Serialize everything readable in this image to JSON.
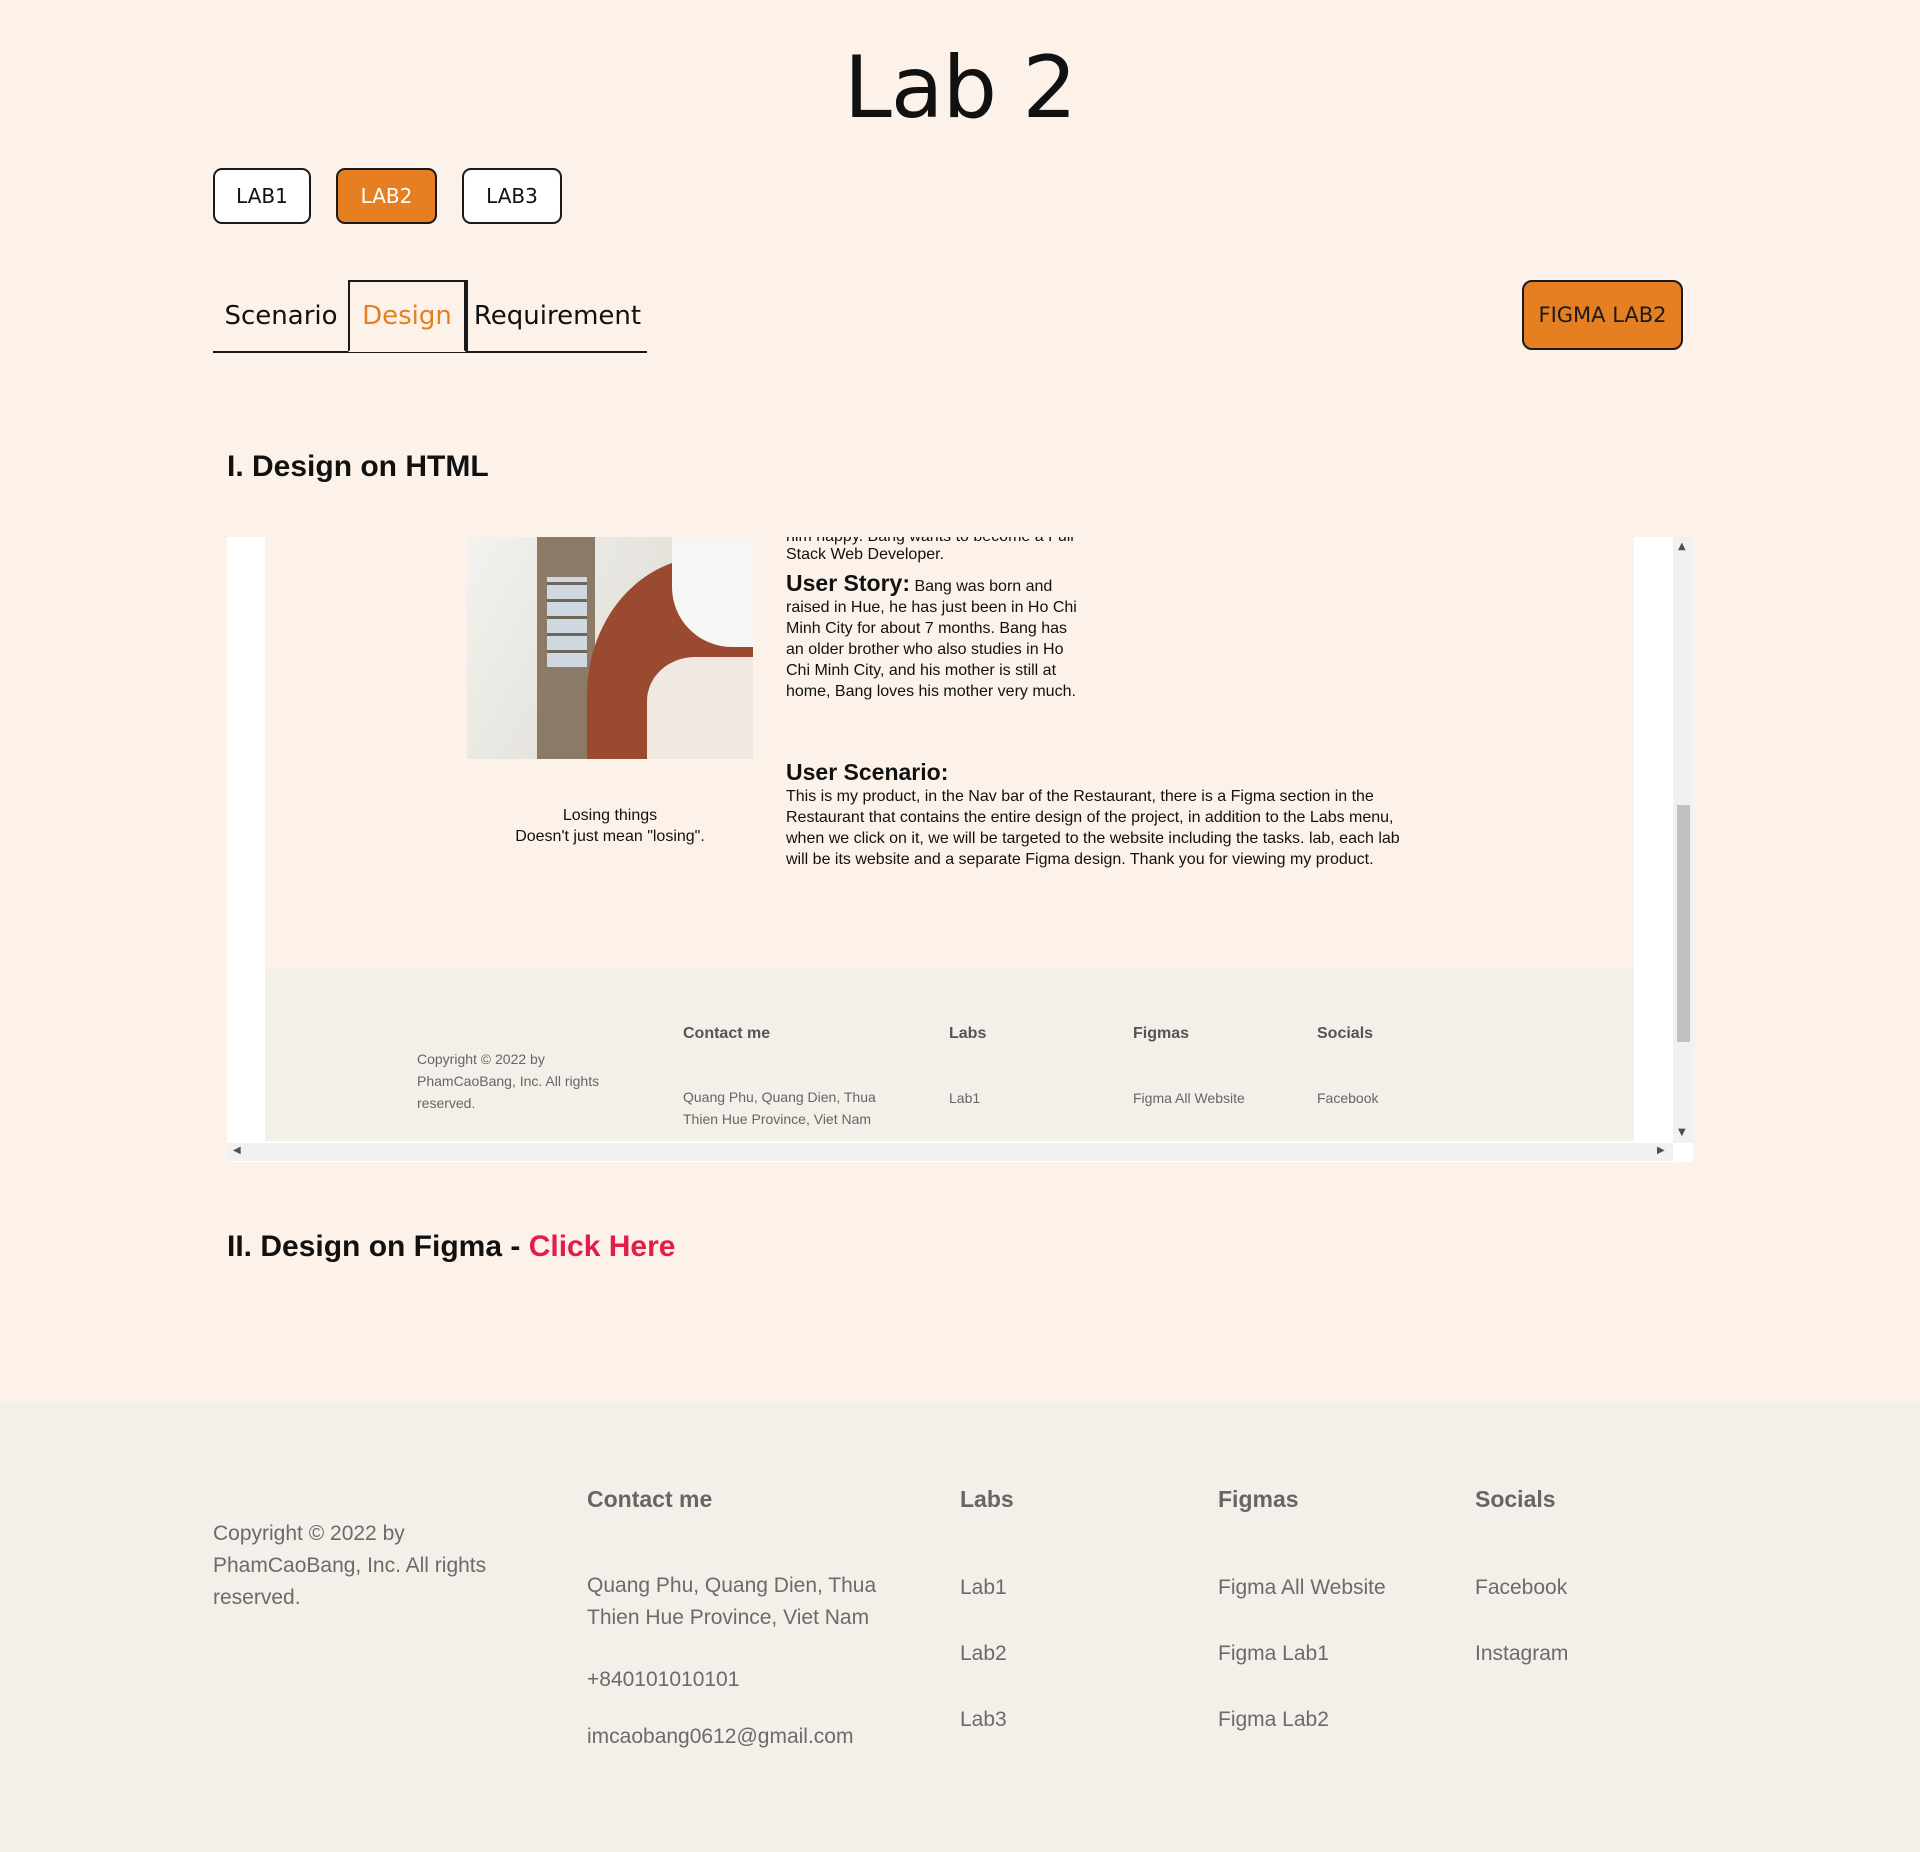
{
  "page": {
    "title": "Lab 2",
    "lab_buttons": [
      "LAB1",
      "LAB2",
      "LAB3"
    ],
    "active_lab": "LAB2",
    "tabs": [
      "Scenario",
      "Design",
      "Requirement"
    ],
    "active_tab": "Design",
    "figma_button": "FIGMA LAB2",
    "section1": "I. Design on HTML",
    "section2_prefix": "II. Design on Figma - ",
    "section2_link": "Click Here",
    "accent_color": "#e67e22",
    "link_color": "#e11d48"
  },
  "embed": {
    "cutoff_line": "him happy. Bang wants to become a Full",
    "cutoff_line2": "Stack Web Developer.",
    "user_story_label": "User Story:",
    "user_story_text_1": "Bang was born and",
    "user_story_text_rest": [
      "raised in Hue, he has just been in Ho Chi",
      "Minh City for about 7 months. Bang has",
      "an older brother who also studies in Ho",
      "Chi Minh City, and his mother is still at",
      "home, Bang loves his mother very much."
    ],
    "user_scenario_label": "User Scenario:",
    "user_scenario_lines": [
      "This is my product, in the Nav bar of the Restaurant, there is a Figma section in the",
      "Restaurant that contains the entire design of the project, in addition to the Labs menu,",
      "when we click on it, we will be targeted to the website including the tasks. lab, each lab",
      "will be its website and a separate Figma design. Thank you for viewing my product."
    ],
    "caption_line1": "Losing things",
    "caption_line2": "Doesn't just mean \"losing\".",
    "footer": {
      "copyright_lines": [
        "Copyright © 2022 by",
        "PhamCaoBang, Inc. All rights",
        "reserved."
      ],
      "contact_heading": "Contact me",
      "labs_heading": "Labs",
      "figmas_heading": "Figmas",
      "socials_heading": "Socials",
      "address_lines": [
        "Quang Phu, Quang Dien, Thua",
        "Thien Hue Province, Viet Nam"
      ],
      "lab1": "Lab1",
      "figma_all": "Figma All Website",
      "facebook": "Facebook"
    }
  },
  "footer": {
    "copyright_lines": [
      "Copyright © 2022 by",
      "PhamCaoBang, Inc. All rights",
      "reserved."
    ],
    "contact_heading": "Contact me",
    "address_lines": [
      "Quang Phu, Quang Dien, Thua",
      "Thien Hue Province, Viet Nam"
    ],
    "phone": "+840101010101",
    "email": "imcaobang0612@gmail.com",
    "labs_heading": "Labs",
    "labs": [
      "Lab1",
      "Lab2",
      "Lab3"
    ],
    "figmas_heading": "Figmas",
    "figmas": [
      "Figma All Website",
      "Figma Lab1",
      "Figma Lab2"
    ],
    "socials_heading": "Socials",
    "socials": [
      "Facebook",
      "Instagram"
    ]
  }
}
